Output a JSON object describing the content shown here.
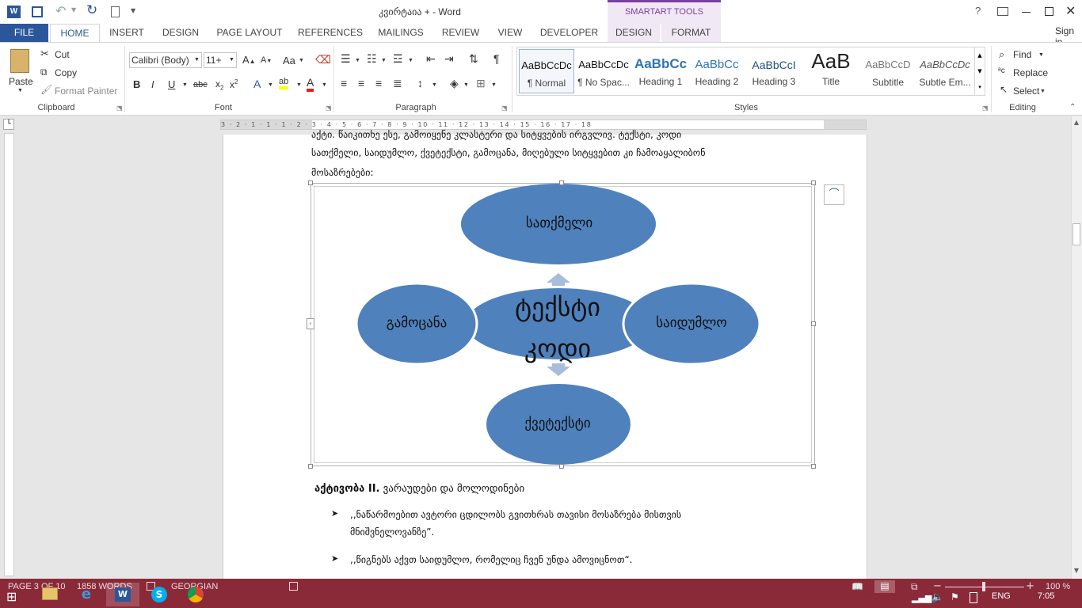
{
  "window": {
    "title": "კვირტაია + - Word",
    "smartart_tools": "SMARTART TOOLS",
    "help": "?",
    "sign_in": "Sign in"
  },
  "tabs": [
    "FILE",
    "HOME",
    "INSERT",
    "DESIGN",
    "PAGE LAYOUT",
    "REFERENCES",
    "MAILINGS",
    "REVIEW",
    "VIEW",
    "DEVELOPER",
    "DESIGN",
    "FORMAT"
  ],
  "clipboard": {
    "paste": "Paste",
    "cut": "Cut",
    "copy": "Copy",
    "format_painter": "Format Painter",
    "label": "Clipboard"
  },
  "font": {
    "name": "Calibri (Body)",
    "size": "11+",
    "label": "Font",
    "aa": "Aa"
  },
  "paragraph": {
    "label": "Paragraph"
  },
  "styles": {
    "label": "Styles",
    "items": [
      {
        "preview": "AaBbCcDc",
        "name": "¶ Normal"
      },
      {
        "preview": "AaBbCcDc",
        "name": "¶ No Spac..."
      },
      {
        "preview": "AaBbCc",
        "name": "Heading 1"
      },
      {
        "preview": "AaBbCc",
        "name": "Heading 2"
      },
      {
        "preview": "AaBbCcI",
        "name": "Heading 3"
      },
      {
        "preview": "AaB",
        "name": "Title"
      },
      {
        "preview": "AaBbCcD",
        "name": "Subtitle"
      },
      {
        "preview": "AaBbCcDc",
        "name": "Subtle Em..."
      }
    ]
  },
  "editing": {
    "find": "Find",
    "replace": "Replace",
    "select": "Select",
    "label": "Editing"
  },
  "ruler": {
    "marks": "3 · 2 · 1 · 1 · 1 · 2 · 3 · 4 · 5 · 6 · 7 · 8 · 9 · 10 · 11 · 12 · 13 · 14 · 15 · 16 · 17 · 18"
  },
  "document": {
    "line1": "აქტი. წაიკითხე ესე, გამოიყენე კლასტერი და სიტყვების ირგვლივ. ტექსტი, კოდი",
    "line2": "სათქმელი, საიდუმლო, ქვეტექსტი, გამოცანა, მიღებული სიტყვებით კი ჩამოაყალიბონ",
    "line3": "მოსაზრებები:",
    "smartart": {
      "center": "ტექსტი კოდი",
      "top": "სათქმელი",
      "left": "გამოცანა",
      "right": "საიდუმლო",
      "bottom": "ქვეტექსტი"
    },
    "activity_bold": "აქტივობა II.",
    "activity_text": "ვარაუდები და მოლოდინები",
    "bullet1_line1": ",,ნაწარმოებით ავტორი ცდილობს გვითხრას თავისი მოსაზრება მისთვის",
    "bullet1_line2": "მნიშვნელოვანზე”.",
    "bullet2": ",,წიგნებს აქვთ საიდუმლო, რომელიც ჩვენ უნდა ამოვიცნოთ“."
  },
  "status": {
    "page": "PAGE 3 OF 10",
    "words": "1858 WORDS",
    "language": "GEORGIAN",
    "zoom": "100 %",
    "lang_indicator": "ENG",
    "time": "7:05"
  },
  "colors": {
    "accent": "#2b579a",
    "ellipse": "#4f81bd",
    "taskbar": "#8a2a39",
    "smartart_tab": "#7b3f9e"
  }
}
